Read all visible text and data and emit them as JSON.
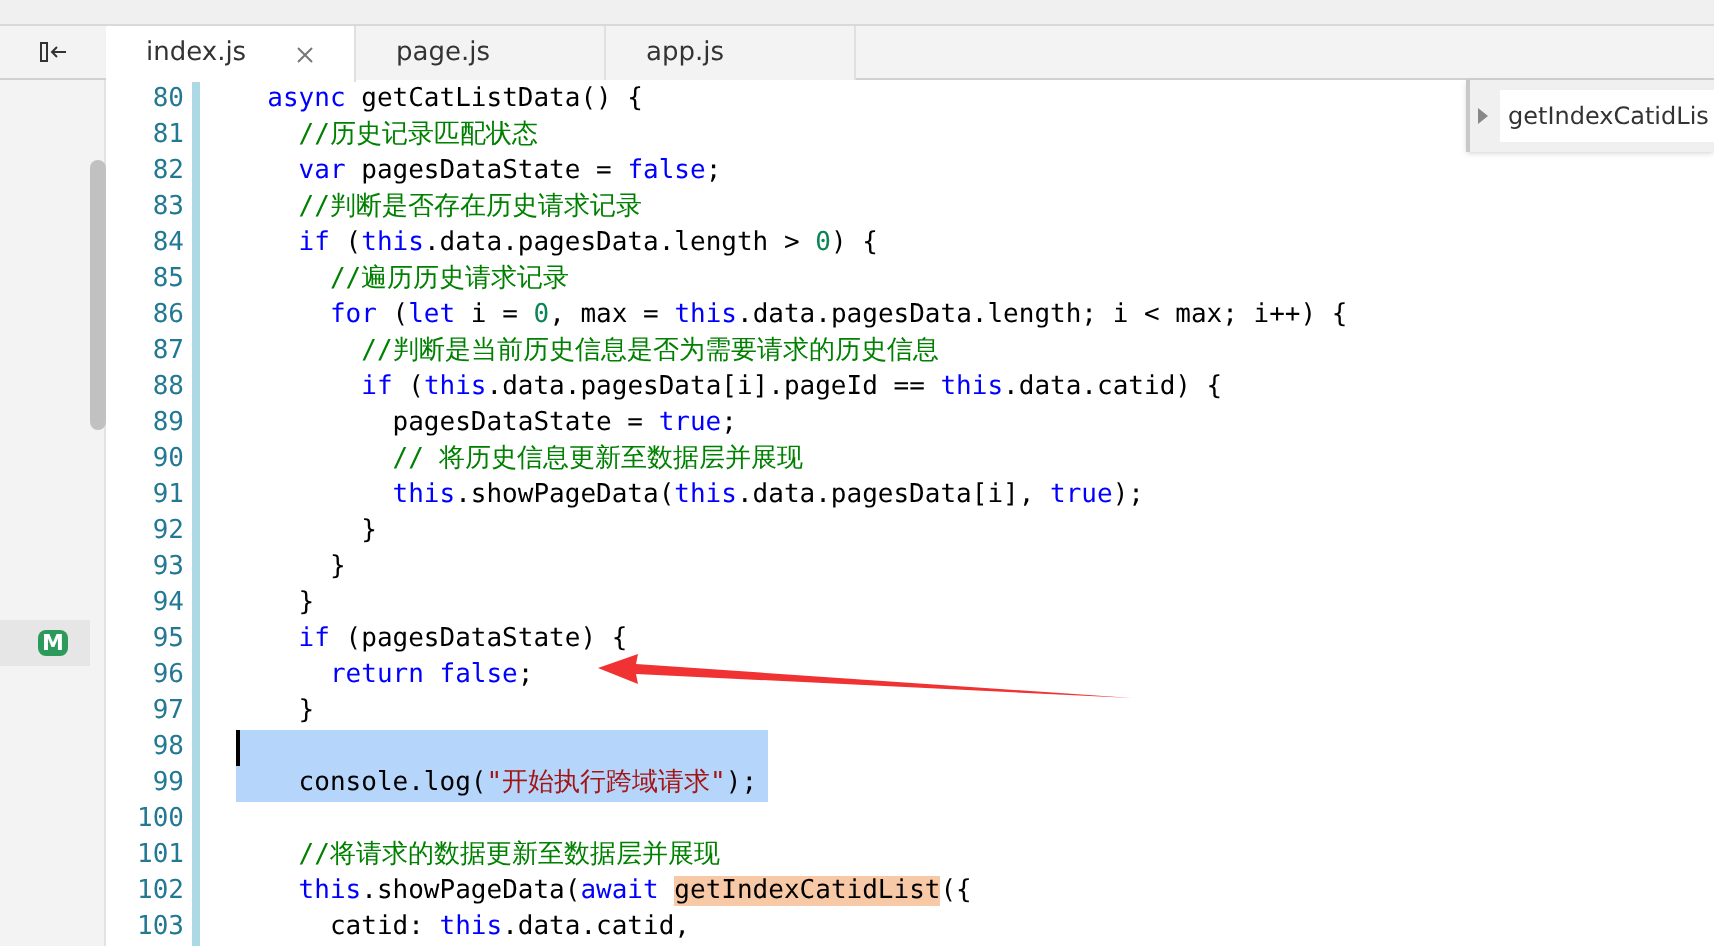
{
  "tabs": [
    {
      "label": "index.js",
      "selected": true
    },
    {
      "label": "page.js",
      "selected": false
    },
    {
      "label": "app.js",
      "selected": false
    }
  ],
  "sidebar": {
    "badge": "M"
  },
  "outline_popup": {
    "label": "getIndexCatidLis"
  },
  "code_lines": [
    {
      "number": "80",
      "selected": false,
      "tokens": [
        {
          "kind": "kw",
          "t": "  async"
        },
        {
          "kind": "plain",
          "t": " getCatListData() {"
        }
      ]
    },
    {
      "number": "81",
      "selected": false,
      "tokens": [
        {
          "kind": "cm",
          "t": "    //历史记录匹配状态"
        }
      ]
    },
    {
      "number": "82",
      "selected": false,
      "tokens": [
        {
          "kind": "kw",
          "t": "    var"
        },
        {
          "kind": "plain",
          "t": " pagesDataState = "
        },
        {
          "kind": "kw",
          "t": "false"
        },
        {
          "kind": "plain",
          "t": ";"
        }
      ]
    },
    {
      "number": "83",
      "selected": false,
      "tokens": [
        {
          "kind": "cm",
          "t": "    //判断是否存在历史请求记录"
        }
      ]
    },
    {
      "number": "84",
      "selected": false,
      "tokens": [
        {
          "kind": "kw",
          "t": "    if"
        },
        {
          "kind": "plain",
          "t": " ("
        },
        {
          "kind": "kw",
          "t": "this"
        },
        {
          "kind": "plain",
          "t": ".data.pagesData.length > "
        },
        {
          "kind": "num",
          "t": "0"
        },
        {
          "kind": "plain",
          "t": ") {"
        }
      ]
    },
    {
      "number": "85",
      "selected": false,
      "tokens": [
        {
          "kind": "cm",
          "t": "      //遍历历史请求记录"
        }
      ]
    },
    {
      "number": "86",
      "selected": false,
      "tokens": [
        {
          "kind": "kw",
          "t": "      for"
        },
        {
          "kind": "plain",
          "t": " ("
        },
        {
          "kind": "kw",
          "t": "let"
        },
        {
          "kind": "plain",
          "t": " i = "
        },
        {
          "kind": "num",
          "t": "0"
        },
        {
          "kind": "plain",
          "t": ", max = "
        },
        {
          "kind": "kw",
          "t": "this"
        },
        {
          "kind": "plain",
          "t": ".data.pagesData.length; i < max; i++) {"
        }
      ]
    },
    {
      "number": "87",
      "selected": false,
      "tokens": [
        {
          "kind": "cm",
          "t": "        //判断是当前历史信息是否为需要请求的历史信息"
        }
      ]
    },
    {
      "number": "88",
      "selected": false,
      "tokens": [
        {
          "kind": "kw",
          "t": "        if"
        },
        {
          "kind": "plain",
          "t": " ("
        },
        {
          "kind": "kw",
          "t": "this"
        },
        {
          "kind": "plain",
          "t": ".data.pagesData[i].pageId == "
        },
        {
          "kind": "kw",
          "t": "this"
        },
        {
          "kind": "plain",
          "t": ".data.catid) {"
        }
      ]
    },
    {
      "number": "89",
      "selected": false,
      "tokens": [
        {
          "kind": "plain",
          "t": "          pagesDataState = "
        },
        {
          "kind": "kw",
          "t": "true"
        },
        {
          "kind": "plain",
          "t": ";"
        }
      ]
    },
    {
      "number": "90",
      "selected": false,
      "tokens": [
        {
          "kind": "cm",
          "t": "          // 将历史信息更新至数据层并展现"
        }
      ]
    },
    {
      "number": "91",
      "selected": false,
      "tokens": [
        {
          "kind": "kw",
          "t": "          this"
        },
        {
          "kind": "plain",
          "t": ".showPageData("
        },
        {
          "kind": "kw",
          "t": "this"
        },
        {
          "kind": "plain",
          "t": ".data.pagesData[i], "
        },
        {
          "kind": "kw",
          "t": "true"
        },
        {
          "kind": "plain",
          "t": ");"
        }
      ]
    },
    {
      "number": "92",
      "selected": false,
      "tokens": [
        {
          "kind": "plain",
          "t": "        }"
        }
      ]
    },
    {
      "number": "93",
      "selected": false,
      "tokens": [
        {
          "kind": "plain",
          "t": "      }"
        }
      ]
    },
    {
      "number": "94",
      "selected": false,
      "tokens": [
        {
          "kind": "plain",
          "t": "    }"
        }
      ]
    },
    {
      "number": "95",
      "selected": false,
      "tokens": [
        {
          "kind": "kw",
          "t": "    if"
        },
        {
          "kind": "plain",
          "t": " (pagesDataState) {"
        }
      ]
    },
    {
      "number": "96",
      "selected": false,
      "tokens": [
        {
          "kind": "kw",
          "t": "      return false"
        },
        {
          "kind": "plain",
          "t": ";"
        }
      ]
    },
    {
      "number": "97",
      "selected": false,
      "tokens": [
        {
          "kind": "plain",
          "t": "    }"
        }
      ]
    },
    {
      "number": "98",
      "selected": true
    },
    {
      "number": "99",
      "selected": true,
      "tokens": [
        {
          "kind": "plain",
          "t": "    console.log("
        },
        {
          "kind": "str",
          "t": "\"开始执行跨域请求\""
        },
        {
          "kind": "plain",
          "t": ");"
        }
      ]
    },
    {
      "number": "100",
      "selected": false
    },
    {
      "number": "101",
      "selected": false,
      "tokens": [
        {
          "kind": "cm",
          "t": "    //将请求的数据更新至数据层并展现"
        }
      ]
    },
    {
      "number": "102",
      "selected": false,
      "tokens": [
        {
          "kind": "kw",
          "t": "    this"
        },
        {
          "kind": "plain",
          "t": ".showPageData("
        },
        {
          "kind": "kw",
          "t": "await "
        },
        {
          "kind": "mark",
          "t": "getIndexCatidList"
        },
        {
          "kind": "plain",
          "t": "({"
        }
      ]
    },
    {
      "number": "103",
      "selected": false,
      "tokens": [
        {
          "kind": "plain",
          "t": "      catid: "
        },
        {
          "kind": "kw",
          "t": "this"
        },
        {
          "kind": "plain",
          "t": ".data.catid,"
        }
      ]
    }
  ]
}
